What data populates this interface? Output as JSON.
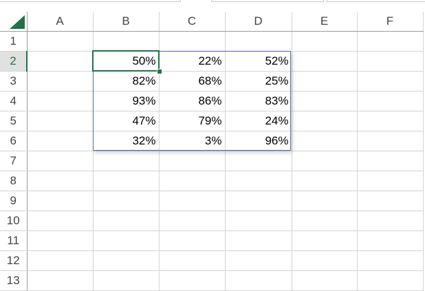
{
  "columns": [
    "A",
    "B",
    "C",
    "D",
    "E",
    "F"
  ],
  "rows": [
    "1",
    "2",
    "3",
    "4",
    "5",
    "6",
    "7",
    "8",
    "9",
    "10",
    "11",
    "12",
    "13"
  ],
  "cells": {
    "2": [
      "",
      "50%",
      "22%",
      "52%",
      "",
      ""
    ],
    "3": [
      "",
      "82%",
      "68%",
      "25%",
      "",
      ""
    ],
    "4": [
      "",
      "93%",
      "86%",
      "83%",
      "",
      ""
    ],
    "5": [
      "",
      "47%",
      "79%",
      "24%",
      "",
      ""
    ],
    "6": [
      "",
      "32%",
      "3%",
      "96%",
      "",
      ""
    ]
  },
  "selected_cell": "B2",
  "colors": {
    "accent": "#217346",
    "range_border": "#4a6fb5"
  }
}
